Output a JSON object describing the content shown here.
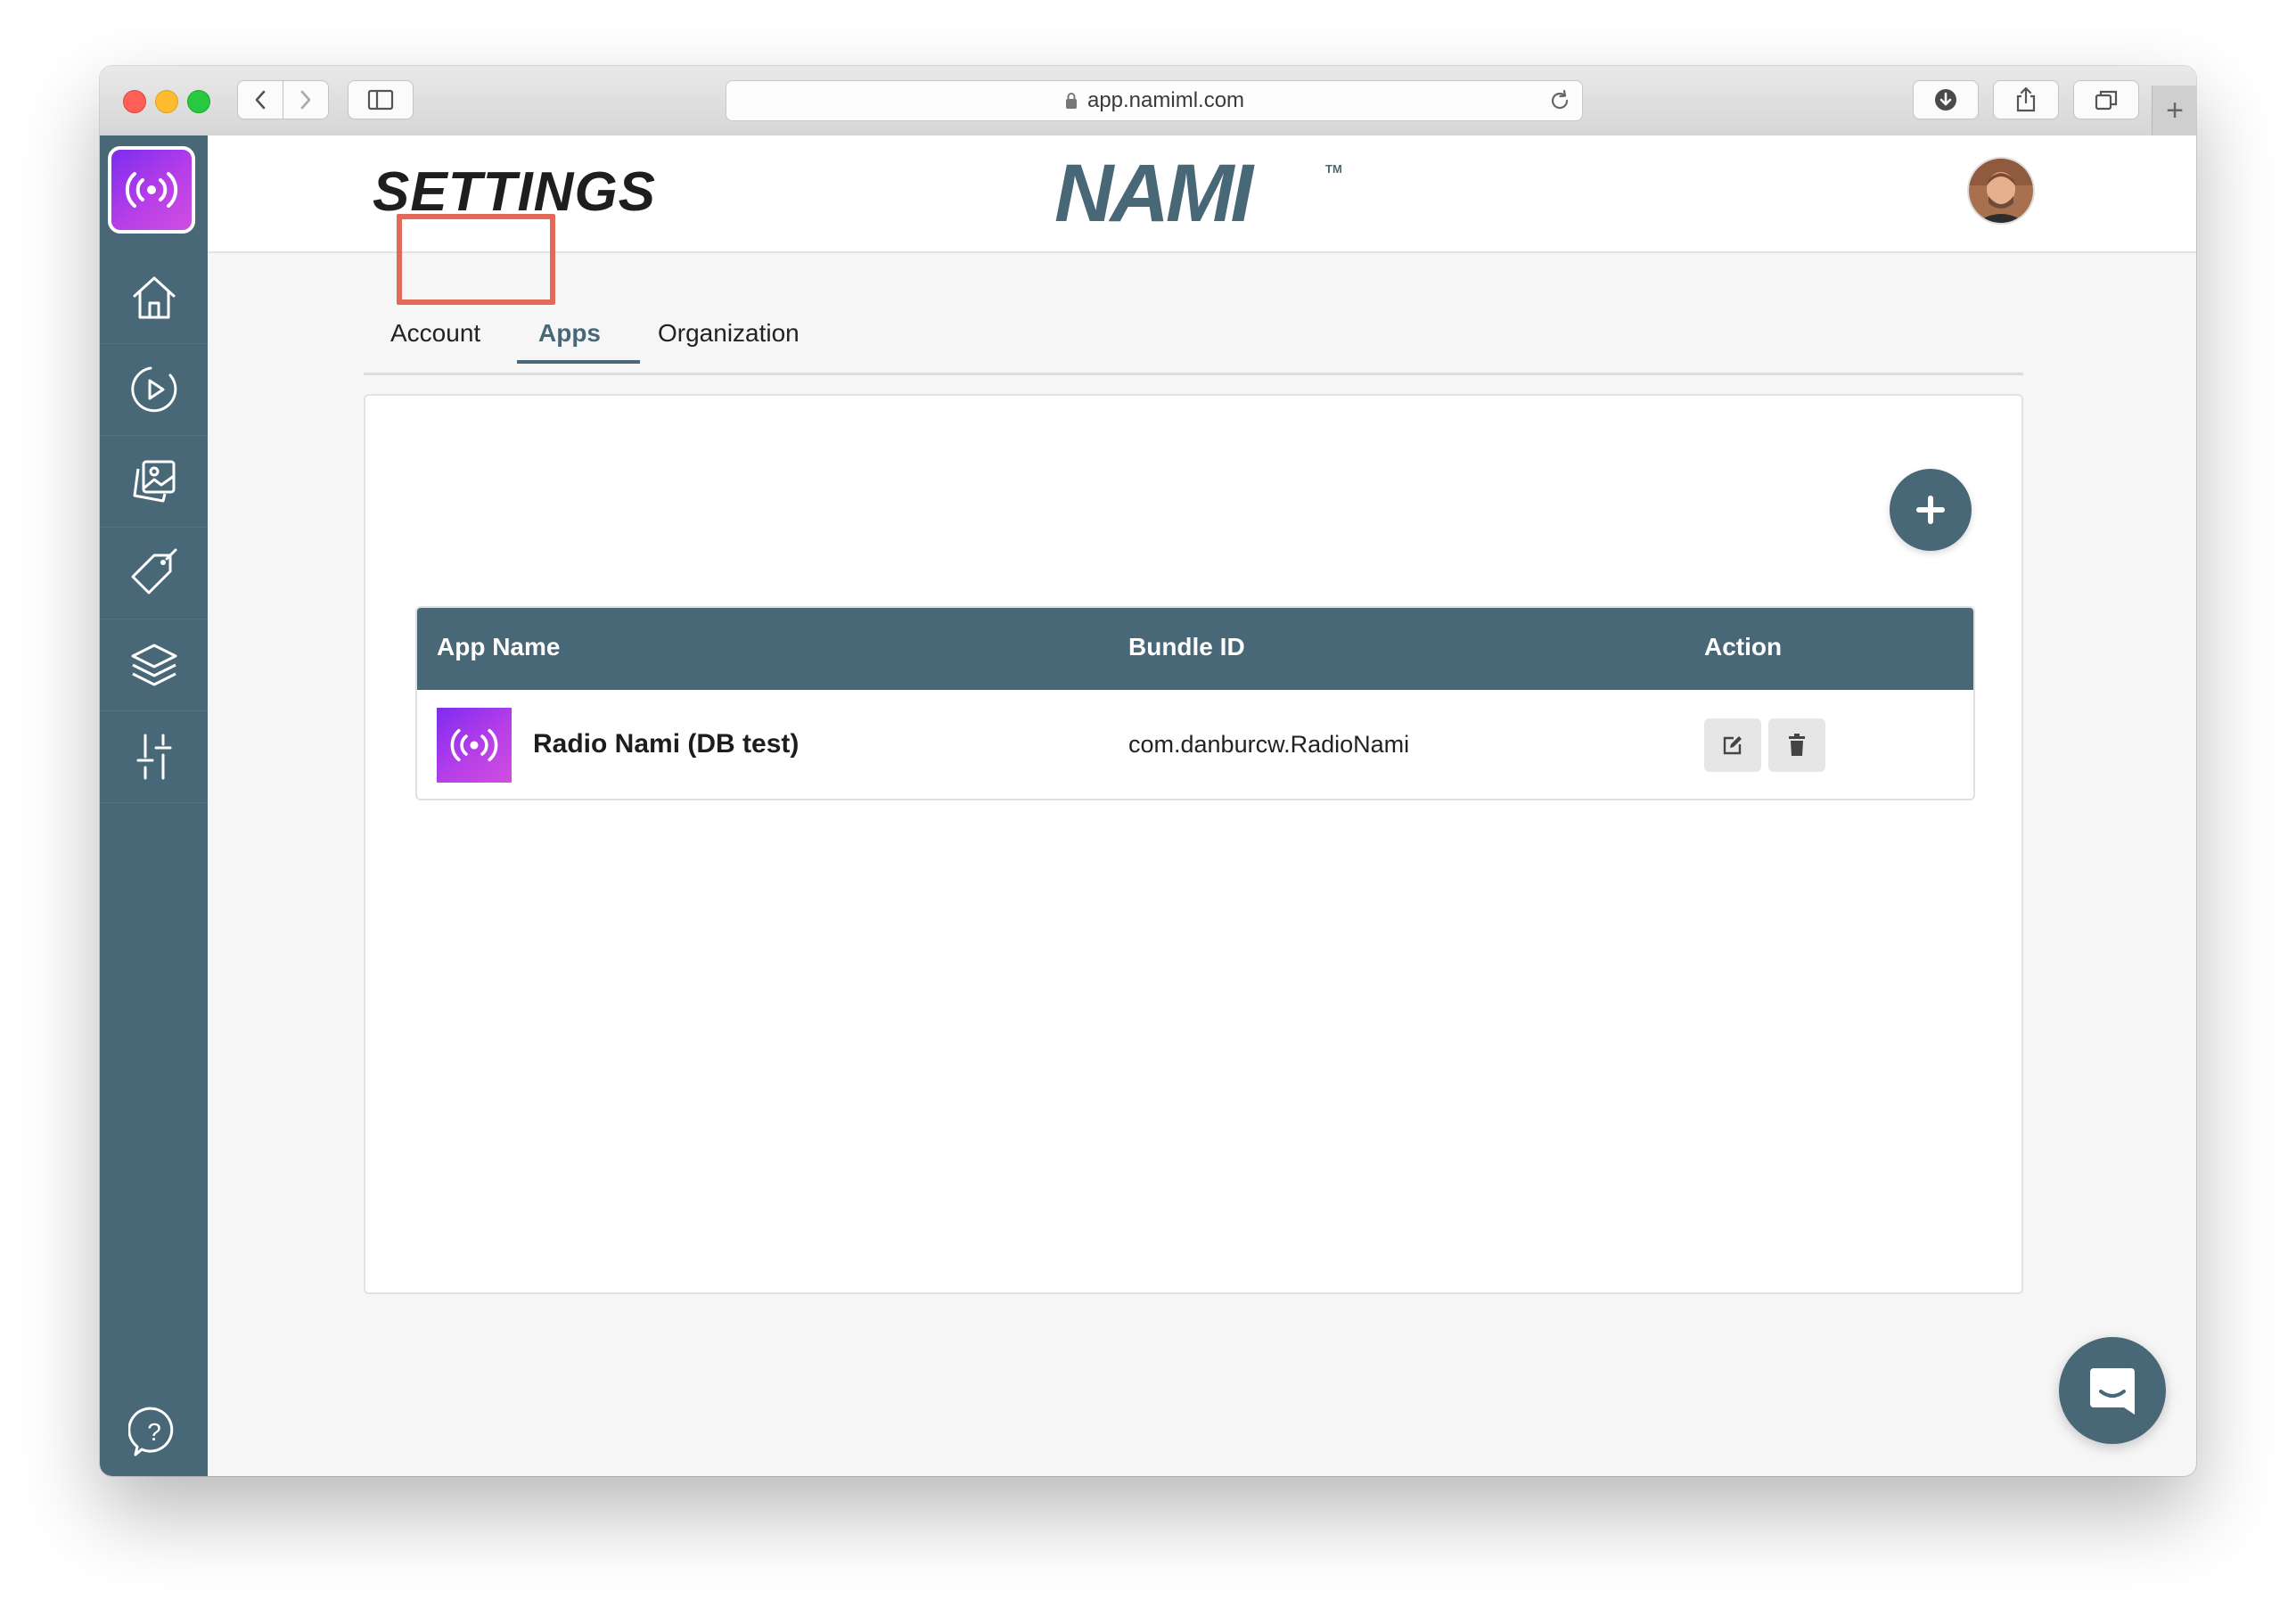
{
  "browser": {
    "url": "app.namiml.com"
  },
  "header": {
    "page_title": "SETTINGS",
    "brand": "NAMI",
    "trademark": "TM"
  },
  "tabs": [
    {
      "label": "Account",
      "active": false
    },
    {
      "label": "Apps",
      "active": true
    },
    {
      "label": "Organization",
      "active": false
    }
  ],
  "table": {
    "columns": [
      "App Name",
      "Bundle ID",
      "Action"
    ],
    "rows": [
      {
        "app_name": "Radio Nami (DB test)",
        "bundle_id": "com.danburcw.RadioNami"
      }
    ]
  },
  "sidebar": {
    "items": [
      {
        "icon": "home-icon"
      },
      {
        "icon": "play-circle-icon"
      },
      {
        "icon": "image-gallery-icon"
      },
      {
        "icon": "tag-icon"
      },
      {
        "icon": "layers-icon"
      },
      {
        "icon": "sliders-icon"
      }
    ],
    "help_icon": "help-icon"
  },
  "colors": {
    "primary": "#496877",
    "highlight": "#e36a5a",
    "app_icon_gradient_start": "#7d2cf0",
    "app_icon_gradient_end": "#d04fe0"
  }
}
